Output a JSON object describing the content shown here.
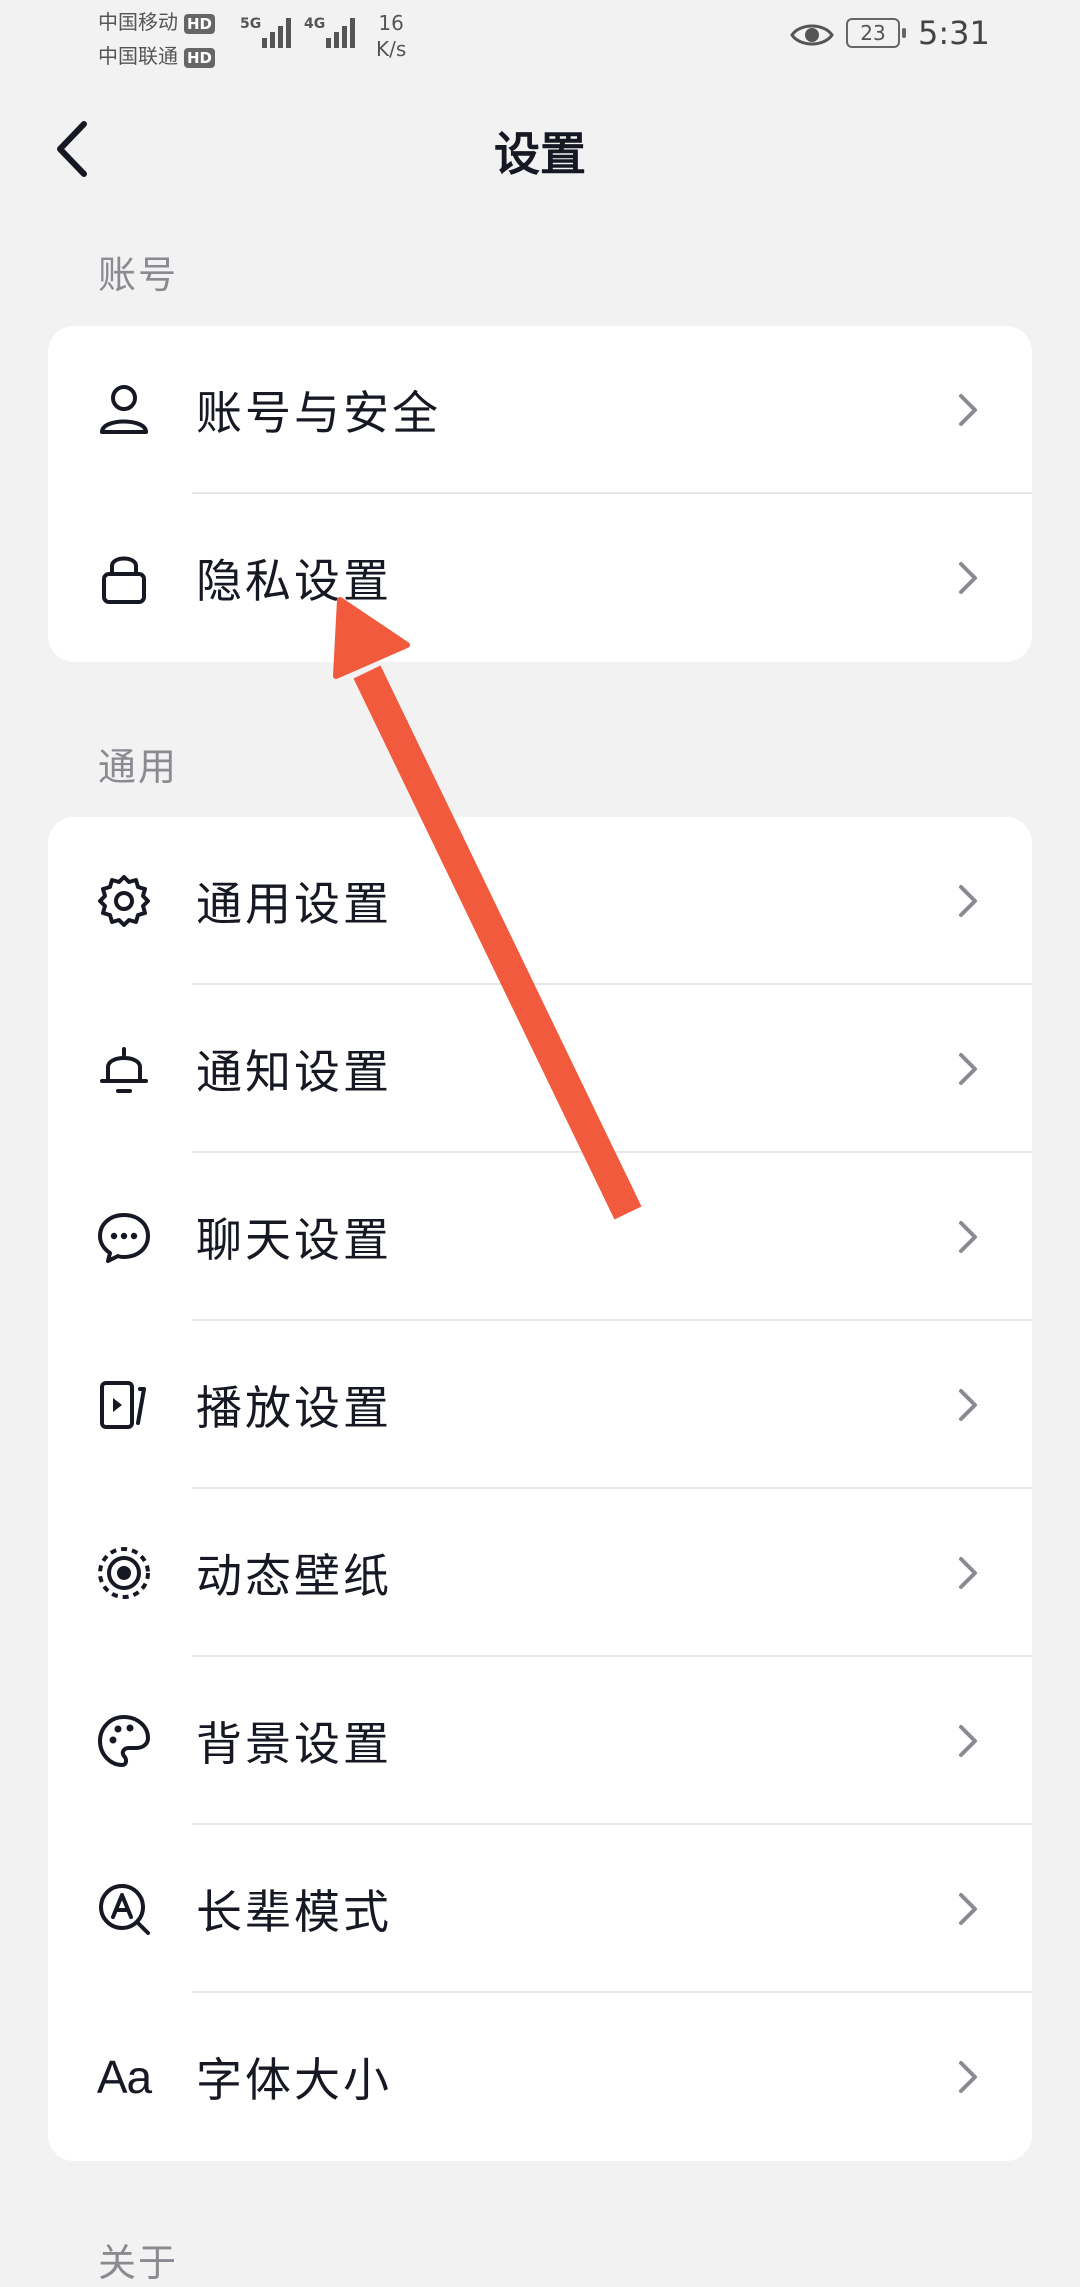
{
  "status_bar": {
    "carrier1": "中国移动",
    "carrier2": "中国联通",
    "hd_badge": "HD",
    "net1": "5G",
    "net2": "4G",
    "speed_value": "16",
    "speed_unit": "K/s",
    "battery": "23",
    "time": "5:31"
  },
  "header": {
    "title": "设置",
    "back_icon": "chevron-left-icon"
  },
  "sections": {
    "account": {
      "label": "账号",
      "items": [
        {
          "label": "账号与安全",
          "icon": "person-icon"
        },
        {
          "label": "隐私设置",
          "icon": "lock-icon"
        }
      ]
    },
    "general": {
      "label": "通用",
      "items": [
        {
          "label": "通用设置",
          "icon": "gear-icon"
        },
        {
          "label": "通知设置",
          "icon": "bell-icon"
        },
        {
          "label": "聊天设置",
          "icon": "chat-bubble-icon"
        },
        {
          "label": "播放设置",
          "icon": "play-screen-icon"
        },
        {
          "label": "动态壁纸",
          "icon": "live-wallpaper-icon"
        },
        {
          "label": "背景设置",
          "icon": "palette-icon"
        },
        {
          "label": "长辈模式",
          "icon": "elder-mode-icon"
        },
        {
          "label": "字体大小",
          "icon": "font-size-icon",
          "icon_text": "Aa"
        }
      ]
    },
    "about": {
      "label": "关于"
    }
  },
  "annotation": {
    "color": "#f25a3d",
    "points_to": "隐私设置"
  }
}
